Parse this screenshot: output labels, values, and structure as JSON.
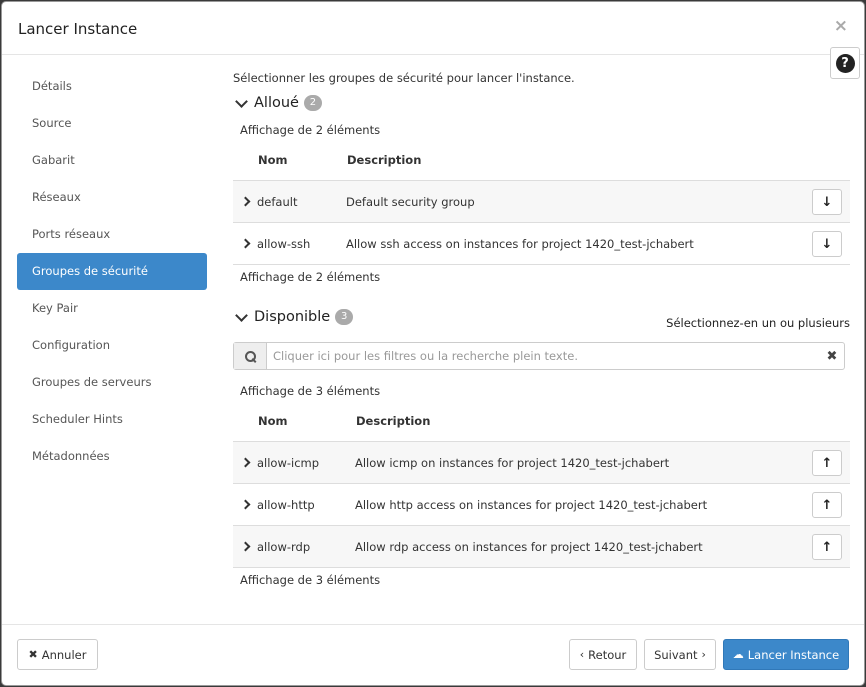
{
  "modal": {
    "title": "Lancer Instance",
    "close_icon": "×",
    "help_icon": "?"
  },
  "sidebar": {
    "items": [
      {
        "label": "Détails"
      },
      {
        "label": "Source"
      },
      {
        "label": "Gabarit"
      },
      {
        "label": "Réseaux"
      },
      {
        "label": "Ports réseaux"
      },
      {
        "label": "Groupes de sécurité",
        "active": true
      },
      {
        "label": "Key Pair"
      },
      {
        "label": "Configuration"
      },
      {
        "label": "Groupes de serveurs"
      },
      {
        "label": "Scheduler Hints"
      },
      {
        "label": "Métadonnées"
      }
    ]
  },
  "content": {
    "intro": "Sélectionner les groupes de sécurité pour lancer l'instance.",
    "allocated": {
      "title": "Alloué",
      "count": "2",
      "count_text": "Affichage de 2 éléments",
      "headers": {
        "name": "Nom",
        "description": "Description"
      },
      "rows": [
        {
          "name": "default",
          "description": "Default security group",
          "action": "↓"
        },
        {
          "name": "allow-ssh",
          "description": "Allow ssh access on instances for project 1420_test-jchabert",
          "action": "↓"
        }
      ]
    },
    "available": {
      "title": "Disponible",
      "count": "3",
      "select_hint": "Sélectionnez-en un ou plusieurs",
      "search_placeholder": "Cliquer ici pour les filtres ou la recherche plein texte.",
      "search_value": "",
      "clear_icon": "✖",
      "count_text": "Affichage de 3 éléments",
      "headers": {
        "name": "Nom",
        "description": "Description"
      },
      "rows": [
        {
          "name": "allow-icmp",
          "description": "Allow icmp on instances for project 1420_test-jchabert",
          "action": "↑"
        },
        {
          "name": "allow-http",
          "description": "Allow http access on instances for project 1420_test-jchabert",
          "action": "↑"
        },
        {
          "name": "allow-rdp",
          "description": "Allow rdp access on instances for project 1420_test-jchabert",
          "action": "↑"
        }
      ]
    }
  },
  "footer": {
    "cancel_icon": "✖",
    "cancel_label": "Annuler",
    "back_icon": "‹",
    "back_label": "Retour",
    "next_label": "Suivant",
    "next_icon": "›",
    "launch_icon": "☁",
    "launch_label": "Lancer Instance"
  },
  "colors": {
    "accent": "#3c88ca",
    "badge": "#aaaaaa",
    "row_alt": "#f7f7f7"
  }
}
